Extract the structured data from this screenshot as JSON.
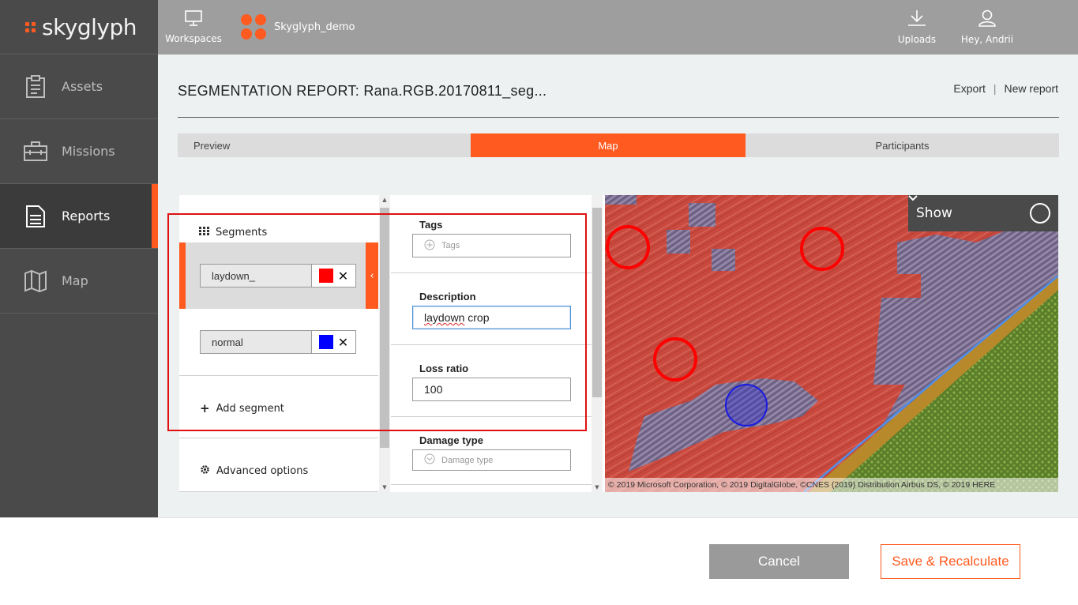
{
  "app": {
    "logo_text": "skyglyph"
  },
  "sidebar": {
    "items": [
      {
        "label": "Assets",
        "icon": "clipboard-icon",
        "active": false
      },
      {
        "label": "Missions",
        "icon": "briefcase-icon",
        "active": false
      },
      {
        "label": "Reports",
        "icon": "document-icon",
        "active": true
      },
      {
        "label": "Map",
        "icon": "map-icon",
        "active": false
      }
    ]
  },
  "topbar": {
    "workspaces_label": "Workspaces",
    "workspace_name": "Skyglyph_demo",
    "uploads_label": "Uploads",
    "user_label": "Hey, Andrii"
  },
  "report": {
    "title": "SEGMENTATION REPORT: Rana.RGB.20170811_seg...",
    "export_label": "Export",
    "separator": "|",
    "new_report_label": "New report"
  },
  "tabs": [
    {
      "label": "Preview",
      "active": false
    },
    {
      "label": "Map",
      "active": true
    },
    {
      "label": "Participants",
      "active": false
    }
  ],
  "segments_panel": {
    "header": "Segments",
    "segments": [
      {
        "name": "laydown_",
        "color": "#ff0000",
        "selected": true
      },
      {
        "name": "normal",
        "color": "#0000ff",
        "selected": false
      }
    ],
    "collapse_glyph": "‹",
    "add_segment_label": "Add segment",
    "advanced_options_label": "Advanced options"
  },
  "details_panel": {
    "tags_label": "Tags",
    "tags_placeholder": "Tags",
    "description_label": "Description",
    "description_value_word1": "laydown",
    "description_value_word2": " crop",
    "loss_ratio_label": "Loss ratio",
    "loss_ratio_value": "100",
    "damage_type_label": "Damage type",
    "damage_type_placeholder": "Damage type"
  },
  "map": {
    "show_label": "Show",
    "attribution": "© 2019 Microsoft Corporation, © 2019 DigitalGlobe, ©CNES (2019) Distribution Airbus DS, © 2019 HERE"
  },
  "footer": {
    "cancel_label": "Cancel",
    "save_label": "Save & Recalculate"
  },
  "colors": {
    "accent": "#ff5a1f",
    "sidebar_bg": "#4a4a4a",
    "topbar_bg": "#9e9e9e",
    "segment_laydown": "#ff0000",
    "segment_normal": "#0000ff"
  }
}
